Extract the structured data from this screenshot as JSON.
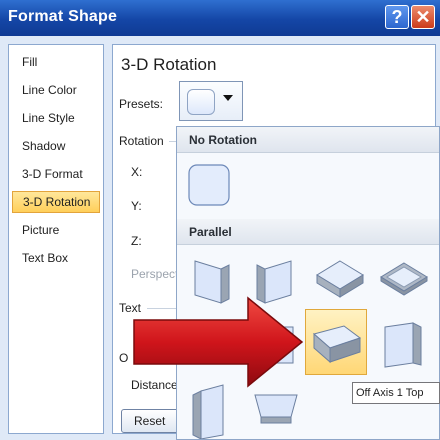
{
  "window": {
    "title": "Format Shape",
    "help_glyph": "?",
    "close_glyph": "✕"
  },
  "nav": {
    "items": [
      {
        "label": "Fill",
        "selected": false
      },
      {
        "label": "Line Color",
        "selected": false
      },
      {
        "label": "Line Style",
        "selected": false
      },
      {
        "label": "Shadow",
        "selected": false
      },
      {
        "label": "3-D Format",
        "selected": false
      },
      {
        "label": "3-D Rotation",
        "selected": true
      },
      {
        "label": "Picture",
        "selected": false
      },
      {
        "label": "Text Box",
        "selected": false
      }
    ]
  },
  "panel": {
    "title": "3-D Rotation",
    "presets_label": "Presets:",
    "rotation_label": "Rotation",
    "x_label": "X:",
    "y_label": "Y:",
    "z_label": "Z:",
    "perspective_label": "Perspect",
    "text_label": "Text",
    "object_label": "O",
    "distance_label": "Distance",
    "reset_label": "Reset"
  },
  "gallery": {
    "section_no_rotation": "No Rotation",
    "section_parallel": "Parallel",
    "hovered_item": "Off Axis 1 Top"
  },
  "tooltip": {
    "text": "Off Axis 1 Top"
  },
  "colors": {
    "titlebar": "#1446a6",
    "selection": "#ffd776",
    "arrow_red": "#d0151b",
    "shape_face": "#dbe6fa"
  }
}
